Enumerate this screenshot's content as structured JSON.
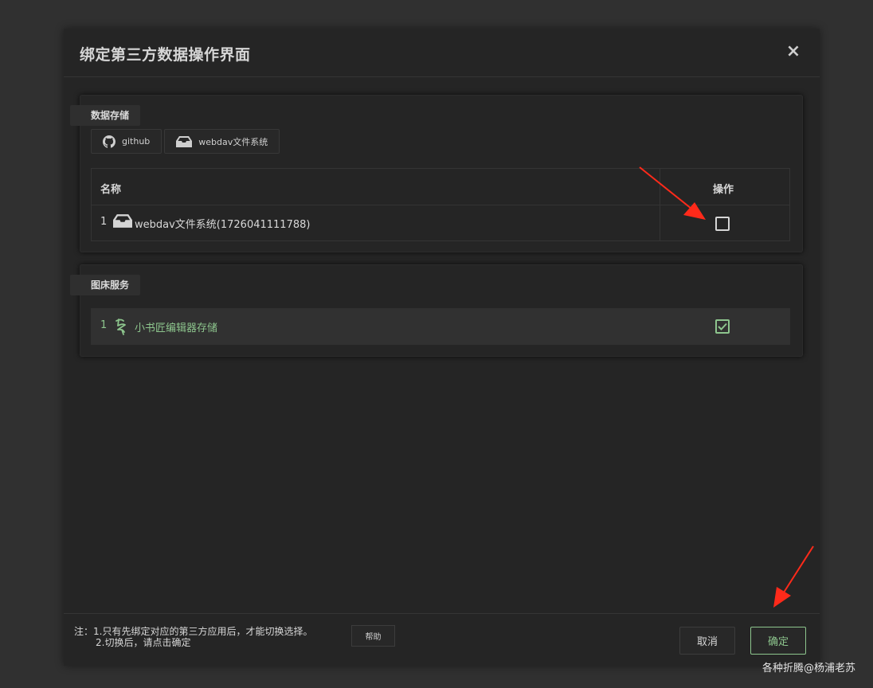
{
  "dialog": {
    "title": "绑定第三方数据操作界面",
    "close_symbol": "×"
  },
  "storage_panel": {
    "tab_label": "数据存储",
    "sources": [
      {
        "label": "github",
        "icon": "github-icon"
      },
      {
        "label": "webdav文件系统",
        "icon": "inbox-icon"
      }
    ],
    "table": {
      "headers": {
        "name": "名称",
        "operation": "操作"
      },
      "rows": [
        {
          "index": "1",
          "icon": "inbox-icon",
          "name": "webdav文件系统(1726041111788)",
          "checked": false
        }
      ]
    }
  },
  "image_panel": {
    "tab_label": "图床服务",
    "rows": [
      {
        "index": "1",
        "icon": "xiaoshujiang-logo-icon",
        "name": "小书匠编辑器存储",
        "checked": true
      }
    ]
  },
  "footer": {
    "note_line1": "注：1.只有先绑定对应的第三方应用后，才能切换选择。",
    "note_line2": "2.切换后，请点击确定",
    "help_label": "帮助",
    "cancel_label": "取消",
    "ok_label": "确定"
  },
  "watermark": "各种折腾@杨浦老苏",
  "colors": {
    "background": "#303030",
    "dialog": "#252525",
    "accent_green": "#8dc58d",
    "annotation_arrow": "#ff2a1a"
  }
}
